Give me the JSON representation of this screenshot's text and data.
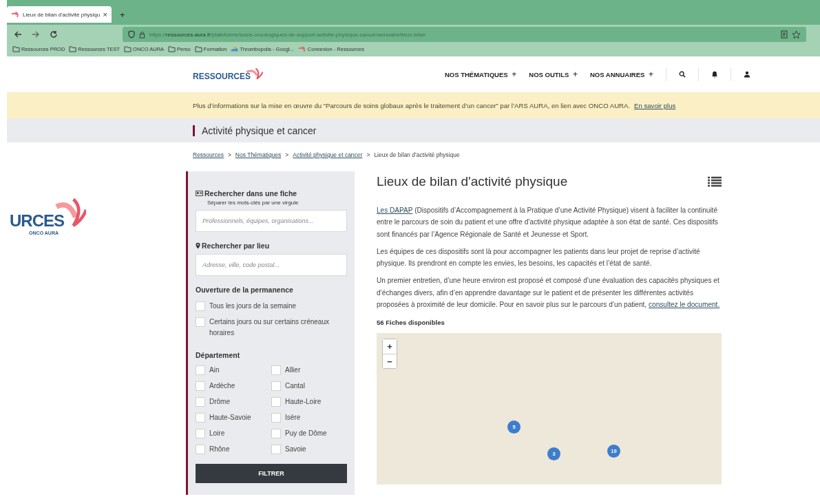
{
  "browser": {
    "tab": {
      "title": "Lieux de bilan d'activité physiqu",
      "close": "×"
    },
    "new_tab": "+",
    "url": {
      "scheme": "https://",
      "domain": "ressources-aura.fr",
      "path": "/plateforme/soins-oncologiques-de-support-activite-physique-cancer/annuaire/lieux-bilan"
    },
    "bookmarks": [
      {
        "kind": "folder",
        "label": "Ressources PROD"
      },
      {
        "kind": "folder",
        "label": "Ressources TEST"
      },
      {
        "kind": "folder",
        "label": "ONCO AURA"
      },
      {
        "kind": "folder",
        "label": "Perso"
      },
      {
        "kind": "folder",
        "label": "Formation"
      },
      {
        "kind": "drive",
        "label": "Thrombopolis - Googl..."
      },
      {
        "kind": "site",
        "label": "Connexion - Ressources"
      }
    ]
  },
  "header": {
    "logo": "RESSOURCES",
    "nav": [
      {
        "label": "NOS THÉMATIQUES",
        "expander": "+"
      },
      {
        "label": "NOS OUTILS",
        "expander": "+"
      },
      {
        "label": "NOS ANNUAIRES",
        "expander": "+"
      }
    ]
  },
  "banner": {
    "text": "Plus d’informations sur la mise en œuvre du “Parcours de soins globaux après le traitement d’un cancer” par l’ARS AURA, en lien avec ONCO AURA.",
    "link": "En savoir plus"
  },
  "section_title": "Activité physique et cancer",
  "breadcrumb": {
    "separator": ">",
    "items": [
      {
        "label": "Ressources",
        "link": true
      },
      {
        "label": "Nos Thématiques",
        "link": true
      },
      {
        "label": "Activité physique et cancer",
        "link": true
      },
      {
        "label": "Lieux de bilan d’activité physique",
        "link": false
      }
    ]
  },
  "side_logo": {
    "text": "URCES",
    "subtitle": "ONCO AURA"
  },
  "filters": {
    "keyword": {
      "label": "Rechercher dans une fiche",
      "hint": "Séparer les mots-clés par une virgule",
      "placeholder": "Professionnels, équipes, organisations..."
    },
    "place": {
      "label": "Rechercher par lieu",
      "placeholder": "Adresse, ville, code postal..."
    },
    "opening": {
      "title": "Ouverture de la permanence",
      "options": [
        {
          "label": "Tous les jours de la semaine",
          "checked": false
        },
        {
          "label": "Certains jours ou sur certains créneaux horaires",
          "checked": false
        }
      ]
    },
    "departments": {
      "title": "Département",
      "options": [
        {
          "label": "Ain",
          "checked": false
        },
        {
          "label": "Allier",
          "checked": false
        },
        {
          "label": "Ardèche",
          "checked": false
        },
        {
          "label": "Cantal",
          "checked": false
        },
        {
          "label": "Drôme",
          "checked": false
        },
        {
          "label": "Haute-Loire",
          "checked": false
        },
        {
          "label": "Haute-Savoie",
          "checked": false
        },
        {
          "label": "Isère",
          "checked": false
        },
        {
          "label": "Loire",
          "checked": false
        },
        {
          "label": "Puy de Dôme",
          "checked": false
        },
        {
          "label": "Rhône",
          "checked": false
        },
        {
          "label": "Savoie",
          "checked": false
        }
      ]
    },
    "button": "FILTRER"
  },
  "content": {
    "title": "Lieux de bilan d'activité physique",
    "paragraphs": [
      [
        {
          "text": "Les DAPAP",
          "link": true
        },
        {
          "text": " (Dispositifs d’Accompagnement à la Pratique d’une Activité Physique) visent à faciliter la continuité entre le parcours de soin du patient et une offre d’activité physique adaptée à son état de santé. Ces dispositifs sont financés par l’Agence Régionale de Santé et Jeunesse et Sport.",
          "link": false
        }
      ],
      [
        {
          "text": "Les équipes de ces dispositifs sont là pour accompagner les patients dans leur projet de reprise d’activité physique. Ils prendront en compte les envies, les besoins, les capacités et l’état de santé.",
          "link": false
        }
      ],
      [
        {
          "text": "Un premier entretien, d’une heure environ est proposé et composé d’une évaluation des capacités physiques et d’échanges divers, afin d’en apprendre davantage sur le patient et de présenter les différentes activités proposées à proximité de leur domicile. Pour en savoir plus sur le parcours d’un patient, ",
          "link": false
        },
        {
          "text": "consultez le document.",
          "link": true
        }
      ]
    ],
    "count": "56 Fiches disponibles",
    "map": {
      "zoom": [
        "+",
        "−"
      ],
      "clusters": [
        {
          "count": "5"
        },
        {
          "count": "3"
        },
        {
          "count": "19"
        }
      ]
    }
  }
}
